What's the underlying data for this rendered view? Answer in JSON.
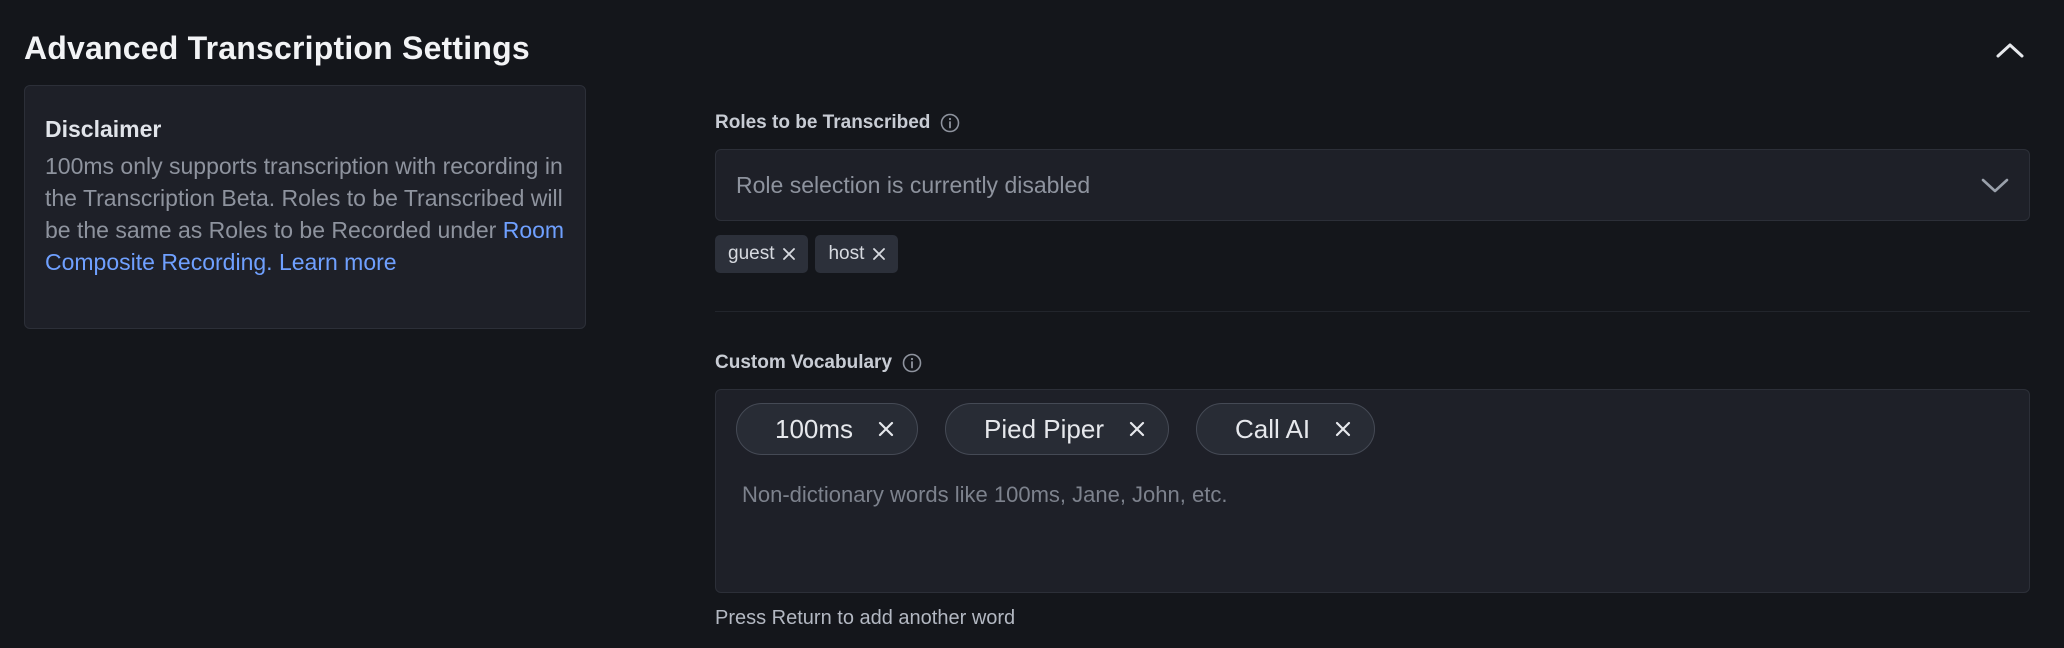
{
  "section": {
    "title": "Advanced Transcription Settings",
    "collapse_icon": "chevron-up-icon"
  },
  "disclaimer": {
    "title": "Disclaimer",
    "body_text": "100ms only supports transcription with recording in the Transcription Beta. Roles to be Transcribed will be the same as Roles to be Recorded under ",
    "link_room_composite": "Room Composite Recording",
    "separator": ".",
    "link_learn_more": "Learn more"
  },
  "roles": {
    "label": "Roles to be Transcribed",
    "info_icon": "info-icon",
    "select_placeholder": "Role selection is currently disabled",
    "dropdown_icon": "chevron-down-icon",
    "tags": [
      "guest",
      "host"
    ]
  },
  "vocabulary": {
    "label": "Custom Vocabulary",
    "info_icon": "info-icon",
    "chips": [
      "100ms",
      "Pied Piper",
      "Call AI"
    ],
    "input_placeholder": "Non-dictionary words like 100ms, Jane, John, etc.",
    "hint": "Press Return to add another word"
  },
  "colors": {
    "background": "#14161b",
    "panel": "#1e2028",
    "link": "#6fa0ff",
    "muted_text": "#8e939e"
  }
}
